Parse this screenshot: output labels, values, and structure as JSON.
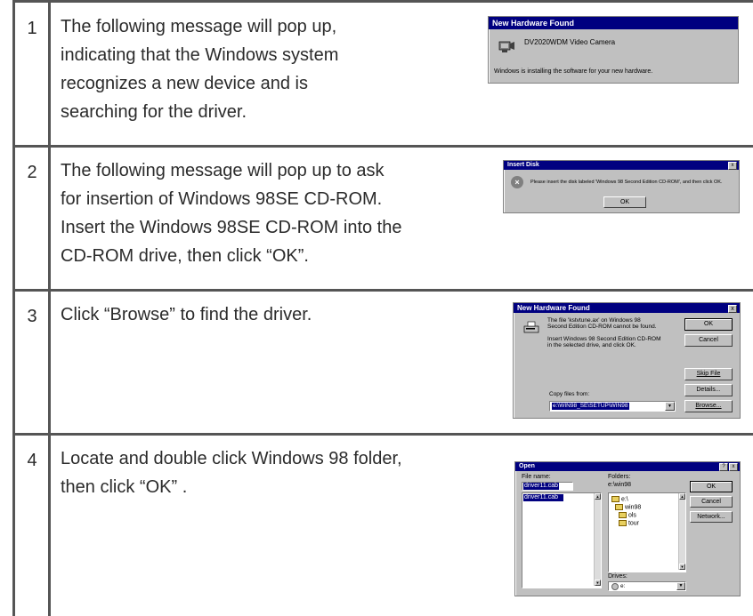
{
  "steps": [
    {
      "number": "1",
      "lines": [
        "The following message will pop up,",
        "indicating that the Windows system",
        "recognizes a new device and is",
        "searching for the driver."
      ]
    },
    {
      "number": "2",
      "lines": [
        "The following message will pop up to ask",
        "for insertion of Windows 98SE CD-ROM.",
        "Insert the Windows 98SE CD-ROM into the",
        "CD-ROM drive, then click “OK”."
      ]
    },
    {
      "number": "3",
      "lines": [
        "Click “Browse” to find the driver."
      ]
    },
    {
      "number": "4",
      "lines": [
        "Locate and double click Windows 98 folder,",
        "then click “OK” ."
      ]
    }
  ],
  "dialog1": {
    "title": "New Hardware Found",
    "device": "DV2020WDM Video Camera",
    "message": "Windows is installing the software for your new hardware."
  },
  "dialog2": {
    "title": "Insert Disk",
    "close": "x",
    "message": "Please insert the disk labeled 'Windows 98 Second Edition CD-ROM', and then click OK.",
    "ok": "OK"
  },
  "dialog3": {
    "title": "New Hardware Found",
    "close": "x",
    "message_lines": [
      "The file 'kstvtune.ax' on Windows 98",
      "Second Edition CD-ROM cannot be found.",
      "",
      "Insert Windows 98 Second Edition CD-ROM",
      "in the selected drive, and click OK."
    ],
    "ok": "OK",
    "cancel": "Cancel",
    "skip_file": "Skip File",
    "details": "Details...",
    "copy_from_label": "Copy files from:",
    "copy_from_value": "e:\\WIN98_SE\\SETUP\\WIN98",
    "browse": "Browse..."
  },
  "dialog4": {
    "title": "Open",
    "help": "?",
    "close": "x",
    "file_name_label": "File name:",
    "file_name_value": "driver11.cab",
    "file_list": [
      "driver11.cab"
    ],
    "folders_label": "Folders:",
    "folders_path": "e:\\win98",
    "folder_items": [
      "e:\\",
      "win98",
      "ols",
      "tour"
    ],
    "ok": "OK",
    "cancel": "Cancel",
    "network": "Network...",
    "drives_label": "Drives:",
    "drive_value": "e:"
  }
}
